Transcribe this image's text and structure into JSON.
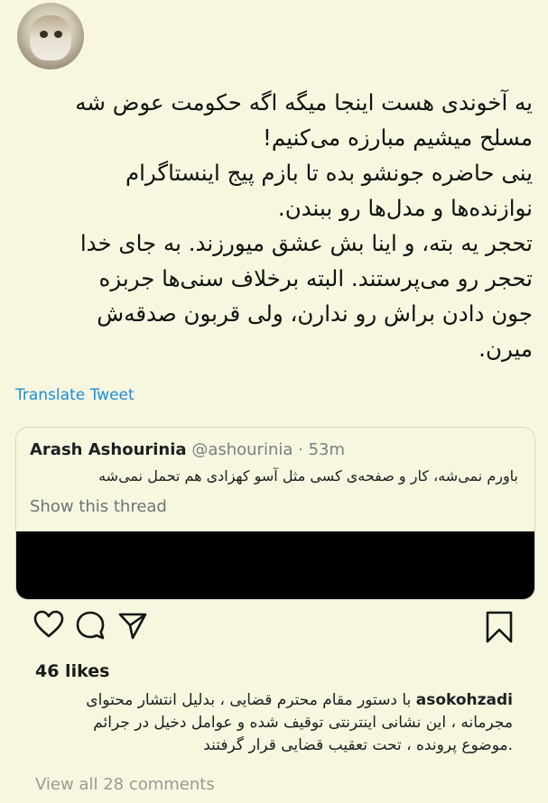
{
  "tweet": {
    "lines": [
      "یه آخوندی هست اینجا میگه اگه حکومت عوض شه",
      "مسلح میشیم مبارزه می‌کنیم!",
      "ینی حاضره جونشو بده تا بازم پیج اینستاگرام",
      "نوازنده‌ها و مدل‌ها رو ببندن.",
      "تحجر یه بته، و اینا بش عشق میورزند. به جای خدا",
      "تحجر رو می‌پرستند. البته برخلاف سنی‌ها جربزه",
      "جون دادن براش رو ندارن، ولی قربون صدقه‌ش",
      "میرن."
    ],
    "translate_label": "Translate Tweet"
  },
  "quote": {
    "name": "Arash Ashourinia",
    "handle": "@ashourinia",
    "time": "53m",
    "text": "باورم نمی‌شه، کار و صفحه‌ی کسی مثل آسو کهزادی هم تحمل نمی‌شه",
    "show_thread": "Show this thread"
  },
  "instagram": {
    "likes": "46 likes",
    "username": "asokohzadi",
    "caption_lines": [
      "با دستور مقام محترم قضایی ، بدلیل انتشار محتوای",
      "مجرمانه ، این نشانی اینترنتی توقیف شده و عوامل دخیل در جرائم",
      ".موضوع پرونده ، تحت تعقیب قضایی قرار گرفتند"
    ],
    "view_all": "View all 28 comments"
  },
  "colors": {
    "background": "#f7f6df",
    "link": "#1a8fd6",
    "muted": "#7b7f84"
  }
}
